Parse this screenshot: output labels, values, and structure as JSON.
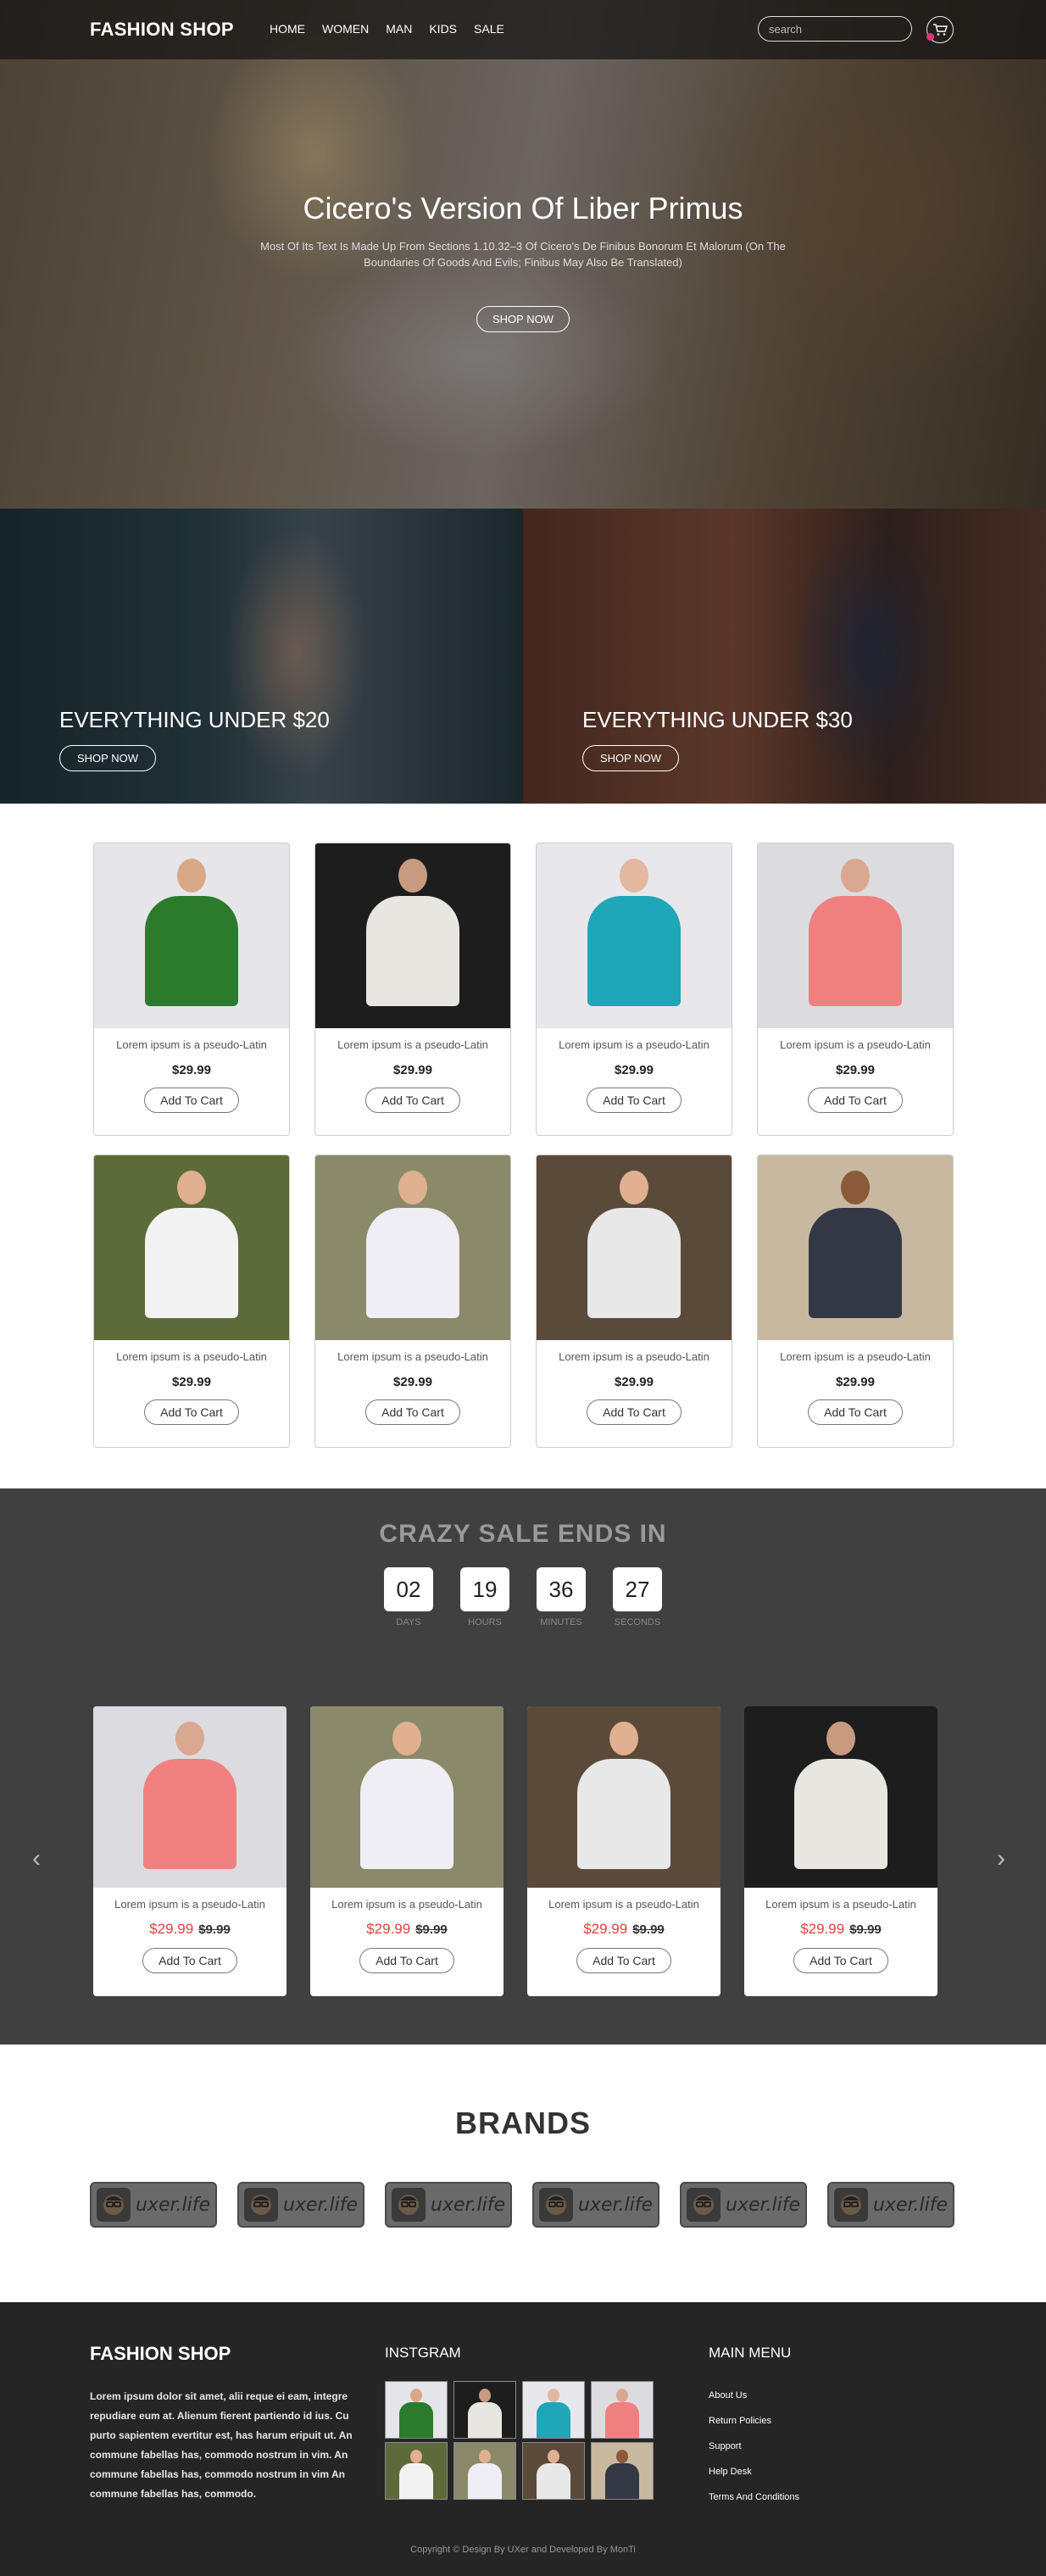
{
  "header": {
    "logo": "FASHION SHOP",
    "nav": [
      "HOME",
      "WOMEN",
      "MAN",
      "KIDS",
      "SALE"
    ],
    "search_placeholder": "search"
  },
  "hero": {
    "title": "Cicero's Version Of Liber Primus",
    "subtitle": "Most Of Its Text Is Made Up From Sections 1.10.32–3 Of Cicero's De Finibus Bonorum Et Malorum (On The Boundaries Of Goods And Evils; Finibus May Also Be Translated)",
    "button": "SHOP NOW"
  },
  "promos": [
    {
      "title": "EVERYTHING UNDER $20",
      "button": "SHOP NOW"
    },
    {
      "title": "EVERYTHING UNDER $30",
      "button": "SHOP NOW"
    }
  ],
  "products": [
    {
      "name": "Lorem ipsum is a pseudo-Latin",
      "price": "$29.99",
      "button": "Add To Cart",
      "bg": "#e6e6ea",
      "shirt": "#2c7a2c",
      "skin": "#d8a888"
    },
    {
      "name": "Lorem ipsum is a pseudo-Latin",
      "price": "$29.99",
      "button": "Add To Cart",
      "bg": "#1d1d1d",
      "shirt": "#e8e6e0",
      "skin": "#c89a80"
    },
    {
      "name": "Lorem ipsum is a pseudo-Latin",
      "price": "$29.99",
      "button": "Add To Cart",
      "bg": "#e8e8ec",
      "shirt": "#1fa6b8",
      "skin": "#e2b8a0"
    },
    {
      "name": "Lorem ipsum is a pseudo-Latin",
      "price": "$29.99",
      "button": "Add To Cart",
      "bg": "#dcdce0",
      "shirt": "#f08080",
      "skin": "#d9a890"
    },
    {
      "name": "Lorem ipsum is a pseudo-Latin",
      "price": "$29.99",
      "button": "Add To Cart",
      "bg": "#5d6a3a",
      "shirt": "#f2f2f2",
      "skin": "#e0b090"
    },
    {
      "name": "Lorem ipsum is a pseudo-Latin",
      "price": "$29.99",
      "button": "Add To Cart",
      "bg": "#8a8a6a",
      "shirt": "#eeeef4",
      "skin": "#e0b090"
    },
    {
      "name": "Lorem ipsum is a pseudo-Latin",
      "price": "$29.99",
      "button": "Add To Cart",
      "bg": "#5a4a3a",
      "shirt": "#e8e8e8",
      "skin": "#e0b090"
    },
    {
      "name": "Lorem ipsum is a pseudo-Latin",
      "price": "$29.99",
      "button": "Add To Cart",
      "bg": "#c8b8a0",
      "shirt": "#333844",
      "skin": "#8a5a3a"
    }
  ],
  "sale": {
    "title": "CRAZY SALE ENDS IN",
    "countdown": [
      {
        "value": "02",
        "label": "DAYS"
      },
      {
        "value": "19",
        "label": "HOURS"
      },
      {
        "value": "36",
        "label": "MINUTES"
      },
      {
        "value": "27",
        "label": "SECONDS"
      }
    ],
    "items": [
      {
        "name": "Lorem ipsum is a pseudo-Latin",
        "price": "$29.99",
        "old_price": "$9.99",
        "button": "Add To Cart",
        "bg": "#dcdce0",
        "shirt": "#f08080",
        "skin": "#d9a890"
      },
      {
        "name": "Lorem ipsum is a pseudo-Latin",
        "price": "$29.99",
        "old_price": "$9.99",
        "button": "Add To Cart",
        "bg": "#8a8a6a",
        "shirt": "#eeeef4",
        "skin": "#e0b090"
      },
      {
        "name": "Lorem ipsum is a pseudo-Latin",
        "price": "$29.99",
        "old_price": "$9.99",
        "button": "Add To Cart",
        "bg": "#5a4a3a",
        "shirt": "#e8e8e8",
        "skin": "#e0b090"
      },
      {
        "name": "Lorem ipsum is a pseudo-Latin",
        "price": "$29.99",
        "old_price": "$9.99",
        "button": "Add To Cart",
        "bg": "#1d1d1d",
        "shirt": "#e8e6e0",
        "skin": "#c89a80"
      }
    ],
    "prev_icon": "chevron-left-icon",
    "next_icon": "chevron-right-icon"
  },
  "brands": {
    "title": "BRANDS",
    "items": [
      "uxer.life",
      "uxer.life",
      "uxer.life",
      "uxer.life",
      "uxer.life",
      "uxer.life"
    ]
  },
  "footer": {
    "logo": "FASHION SHOP",
    "about": "Lorem ipsum dolor sit amet, alii reque ei eam, integre repudiare eum at. Alienum fierent partiendo id ius. Cu purto sapientem evertitur est, has harum eripuit ut. An commune fabellas has, commodo nostrum in vim. An commune fabellas has, commodo nostrum in vim An commune fabellas has, commodo.",
    "instagram_title": "INSTGRAM",
    "menu_title": "MAIN MENU",
    "menu": [
      "About Us",
      "Return Policies",
      "Support",
      "Help Desk",
      "Terms And Conditions"
    ],
    "copyright": "Copyright © Design By UXer and Developed By MonTi"
  },
  "colors": {
    "accent_pink": "#e8307a",
    "sale_red": "#e04040",
    "dark_bg": "#404040",
    "footer_bg": "#252525"
  }
}
